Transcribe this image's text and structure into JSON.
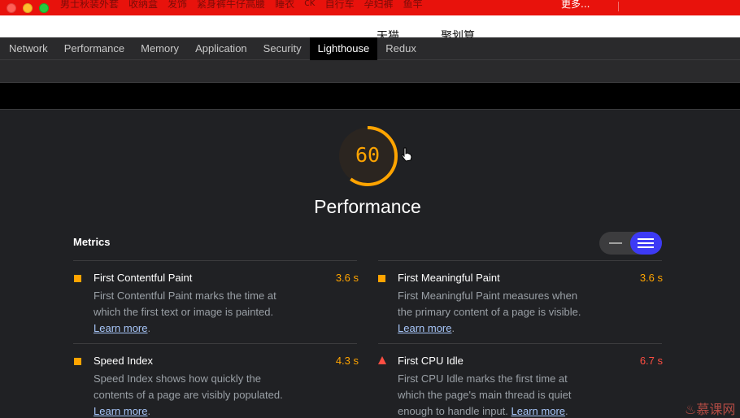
{
  "browser": {
    "bookmarks": [
      "男士秋装外套",
      "收纳盒",
      "发饰",
      "紧身裤牛仔高腰",
      "睡衣",
      "ck",
      "自行车",
      "孕妇裤",
      "鱼竿"
    ],
    "more": "更多...",
    "page_links": [
      "天猫",
      "聚划算"
    ]
  },
  "devtools": {
    "tabs": [
      "Network",
      "Performance",
      "Memory",
      "Application",
      "Security",
      "Lighthouse",
      "Redux"
    ],
    "active_tab": "Lighthouse"
  },
  "report": {
    "score": "60",
    "score_fraction": 0.6,
    "category": "Performance",
    "metrics_title": "Metrics",
    "learn_more": "Learn more",
    "metrics": [
      {
        "title": "First Contentful Paint",
        "value": "3.6 s",
        "rating": "average",
        "desc": "First Contentful Paint marks the time at which the first text or image is painted."
      },
      {
        "title": "First Meaningful Paint",
        "value": "3.6 s",
        "rating": "average",
        "desc": "First Meaningful Paint measures when the primary content of a page is visible."
      },
      {
        "title": "Speed Index",
        "value": "4.3 s",
        "rating": "average",
        "desc": "Speed Index shows how quickly the contents of a page are visibly populated."
      },
      {
        "title": "First CPU Idle",
        "value": "6.7 s",
        "rating": "fail",
        "desc": "First CPU Idle marks the first time at which the page's main thread is quiet enough to handle input."
      }
    ]
  },
  "colors": {
    "average": "#ffa400",
    "fail": "#ff4e42",
    "toggle_active": "#3d3af5",
    "browser_bar": "#e8120c"
  },
  "icons": [
    "traffic-light-close-icon",
    "traffic-light-minimize-icon",
    "traffic-light-zoom-icon",
    "gauge-icon",
    "pointer-cursor-icon",
    "compact-lines-icon",
    "expanded-lines-icon",
    "average-square-icon",
    "fail-triangle-icon",
    "flame-logo-icon"
  ],
  "watermark": "慕课网"
}
